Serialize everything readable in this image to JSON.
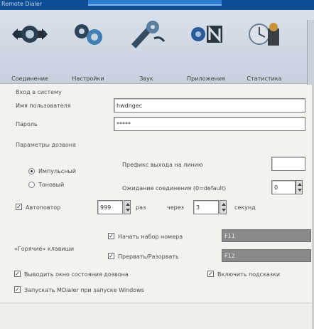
{
  "window": {
    "title": "Remote Dialer"
  },
  "toolbar": {
    "buttons": [
      {
        "label": "Соединение"
      },
      {
        "label": "Настройки"
      },
      {
        "label": "Звук"
      },
      {
        "label": "Приложения"
      },
      {
        "label": "Статистика"
      }
    ]
  },
  "login": {
    "group_title": "Вход в систему",
    "username_label": "Имя пользователя",
    "username_value": "hwdngec",
    "password_label": "Пароль",
    "password_value": "*****"
  },
  "dialing": {
    "group_title": "Параметры дозвона",
    "mode_pulse": "Импульсный",
    "mode_tone": "Тоновый",
    "prefix_label": "Префикс выхода на линию",
    "prefix_value": "",
    "wait_label": "Ожидание соединения (0=default)",
    "wait_value": "0",
    "autoredial_label": "Автоповтор",
    "autoredial_value": "999",
    "times_label": "раз",
    "interval_label": "через",
    "interval_value": "3",
    "seconds_label": "секунд"
  },
  "hotkeys": {
    "group_label": "«Горячие» клавиши",
    "start_label": "Начать набор номера",
    "start_key": "F11",
    "stop_label": "Прервать/Разорвать",
    "stop_key": "F12"
  },
  "options": {
    "show_status": "Выводить окно состояния дозвона",
    "enable_hints": "Включить подсказки",
    "run_on_start": "Запускать MDialer при запуске Windows"
  },
  "colors": {
    "titlebar": "#0c4d95",
    "hotkey_bg": "#8a8a8a"
  }
}
